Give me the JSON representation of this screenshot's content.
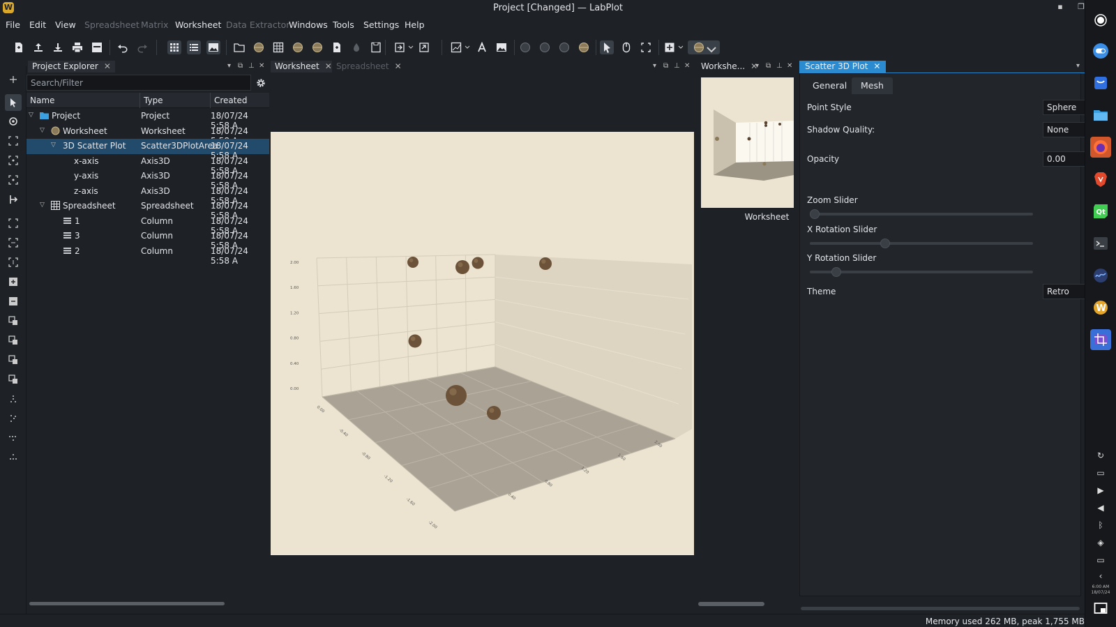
{
  "window": {
    "title": "Project [Changed] — LabPlot",
    "logo": "W"
  },
  "menu": [
    {
      "label": "File",
      "enabled": true
    },
    {
      "label": "Edit",
      "enabled": true
    },
    {
      "label": "View",
      "enabled": true
    },
    {
      "label": "Spreadsheet",
      "enabled": false
    },
    {
      "label": "Matrix",
      "enabled": false
    },
    {
      "label": "Worksheet",
      "enabled": true
    },
    {
      "label": "Data Extractor",
      "enabled": false
    },
    {
      "label": "Windows",
      "enabled": true
    },
    {
      "label": "Tools",
      "enabled": true
    },
    {
      "label": "Settings",
      "enabled": true
    },
    {
      "label": "Help",
      "enabled": true
    }
  ],
  "explorer": {
    "tab_label": "Project Explorer",
    "search_placeholder": "Search/Filter",
    "columns": [
      "Name",
      "Type",
      "Created"
    ],
    "rows": [
      {
        "name": "Project",
        "type": "Project",
        "created": "18/07/24 5:58 A",
        "icon": "folder-icon",
        "expanded": true
      },
      {
        "name": "Worksheet",
        "type": "Worksheet",
        "created": "18/07/24 5:58 A",
        "icon": "worksheet-icon",
        "expanded": true
      },
      {
        "name": "3D Scatter Plot",
        "type": "Scatter3DPlotArea",
        "created": "18/07/24 5:58 A",
        "icon": "none",
        "expanded": true,
        "selected": true
      },
      {
        "name": "x-axis",
        "type": "Axis3D",
        "created": "18/07/24 5:58 A",
        "icon": "none"
      },
      {
        "name": "y-axis",
        "type": "Axis3D",
        "created": "18/07/24 5:58 A",
        "icon": "none"
      },
      {
        "name": "z-axis",
        "type": "Axis3D",
        "created": "18/07/24 5:58 A",
        "icon": "none"
      },
      {
        "name": "Spreadsheet",
        "type": "Spreadsheet",
        "created": "18/07/24 5:58 A",
        "icon": "spreadsheet-icon",
        "expanded": true
      },
      {
        "name": "1",
        "type": "Column",
        "created": "18/07/24 5:58 A",
        "icon": "column-icon"
      },
      {
        "name": "3",
        "type": "Column",
        "created": "18/07/24 5:58 A",
        "icon": "column-icon"
      },
      {
        "name": "2",
        "type": "Column",
        "created": "18/07/24 5:58 A",
        "icon": "column-icon"
      }
    ]
  },
  "worksheet_tabs": [
    "Worksheet",
    "Spreadsheet"
  ],
  "preview": {
    "tab_label": "Workshe...",
    "caption": "Worksheet"
  },
  "properties": {
    "tab_label": "Scatter 3D Plot",
    "subtabs": [
      "General",
      "Mesh"
    ],
    "point_style": {
      "label": "Point Style",
      "value": "Sphere"
    },
    "shadow_quality": {
      "label": "Shadow Quality:",
      "value": "None"
    },
    "opacity": {
      "label": "Opacity",
      "value": "0.00"
    },
    "zoom_slider": {
      "label": "Zoom Slider",
      "level": 0.0
    },
    "x_rotation_slider": {
      "label": "X Rotation Slider",
      "level": 0.33
    },
    "y_rotation_slider": {
      "label": "Y Rotation Slider",
      "level": 0.1
    },
    "theme": {
      "label": "Theme",
      "value": "Retro"
    }
  },
  "plot3d": {
    "vertical_tick_labels": [
      "2.00",
      "1.60",
      "1.20",
      "0.80",
      "0.40",
      "0.00"
    ],
    "floor_tick_labels_front": [
      "-2.00",
      "-1.60",
      "-1.20",
      "-0.80",
      "-0.40",
      "0.00"
    ],
    "floor_tick_labels_right": [
      "0.40",
      "0.80",
      "1.20",
      "1.60",
      "2.00"
    ],
    "colors": {
      "background": "#ece4d0",
      "floor": "#aaa294",
      "wall": "#ddd5c2",
      "point": "#6b5238"
    }
  },
  "status": {
    "memory": "Memory used 262 MB, peak 1,755 MB"
  },
  "clock": {
    "time": "6:00 AM",
    "date": "18/07/24"
  }
}
